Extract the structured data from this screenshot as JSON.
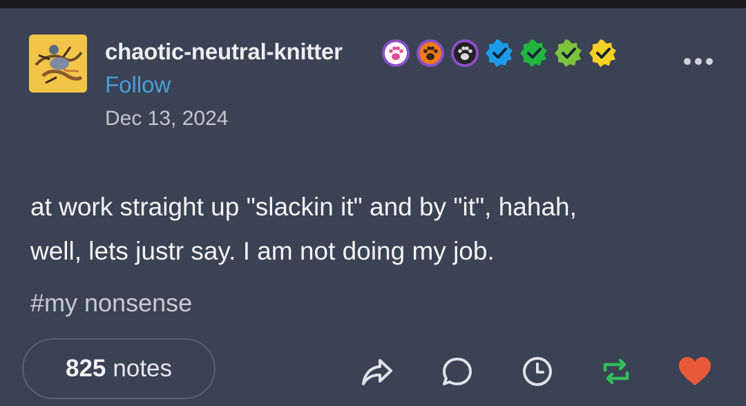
{
  "post": {
    "username": "chaotic-neutral-knitter",
    "follow_label": "Follow",
    "date": "Dec 13, 2024",
    "body_line1": "at work straight up \"slackin it\" and by \"it\", hahah,",
    "body_line2": "well, lets justr say. I am not doing my job.",
    "tag": "#my nonsense",
    "notes_count": "825",
    "notes_label": "notes"
  },
  "badges": [
    {
      "icon": "paw-pink-badge-icon",
      "color": "#e14f9b"
    },
    {
      "icon": "paw-orange-badge-icon",
      "color": "#f07a1c"
    },
    {
      "icon": "paw-black-badge-icon",
      "color": "#222222"
    },
    {
      "icon": "check-blue-badge-icon",
      "color": "#1b9be8"
    },
    {
      "icon": "check-green-badge-icon",
      "color": "#22b43f"
    },
    {
      "icon": "check-lime-badge-icon",
      "color": "#7cc23c"
    },
    {
      "icon": "check-yellow-badge-icon",
      "color": "#f5d123"
    }
  ],
  "actions": [
    {
      "icon": "share-icon"
    },
    {
      "icon": "reply-icon"
    },
    {
      "icon": "clock-icon"
    },
    {
      "icon": "reblog-icon",
      "color": "#2fbf5a"
    },
    {
      "icon": "like-heart-icon",
      "color": "#e8593a"
    }
  ],
  "colors": {
    "background": "#3a4254",
    "link": "#4a9fd8",
    "reblog": "#2fbf5a",
    "like": "#e8593a"
  }
}
